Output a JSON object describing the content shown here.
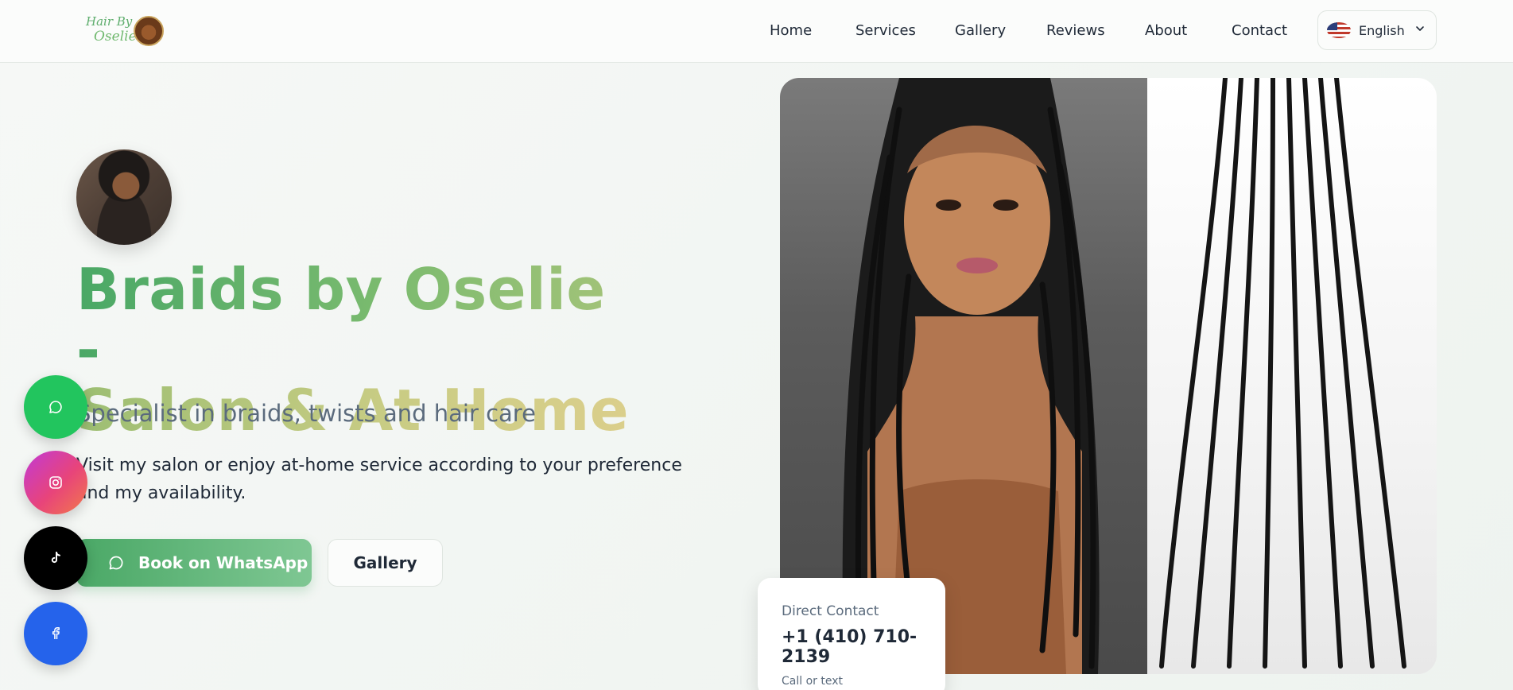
{
  "brand": {
    "logo_line1": "Hair By",
    "logo_line2": "Oselie"
  },
  "nav": {
    "items": [
      "Home",
      "Services",
      "Gallery",
      "Reviews",
      "About",
      "Contact"
    ],
    "language": "English"
  },
  "hero": {
    "title_line1": "Braids by Oselie -",
    "title_line2": "Salon & At Home",
    "subtitle": "Specialist in braids, twists and hair care",
    "description": "Visit my salon or enjoy at-home service according to your preference and my availability.",
    "primary_button": "Book on WhatsApp",
    "secondary_button": "Gallery"
  },
  "contact_card": {
    "label": "Direct Contact",
    "phone": "+1 (410) 710-2139",
    "note": "Call or text"
  },
  "social": [
    {
      "icon": "whatsapp-icon",
      "color": "#22c55e"
    },
    {
      "icon": "instagram-icon",
      "color": "#d946a0"
    },
    {
      "icon": "tiktok-icon",
      "color": "#000000"
    },
    {
      "icon": "facebook-icon",
      "color": "#2563eb"
    }
  ],
  "colors": {
    "accent_green": "#4aa866",
    "accent_gold": "#dccf8c",
    "text_dark": "#1f2937",
    "text_muted": "#5b6b7d"
  }
}
